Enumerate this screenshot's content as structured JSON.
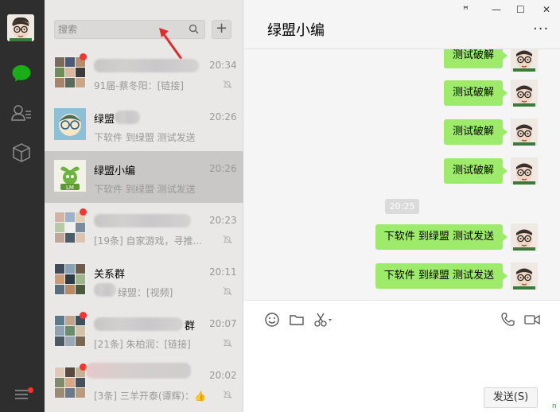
{
  "search": {
    "placeholder": "搜索"
  },
  "add_label": "+",
  "chats": [
    {
      "name": "",
      "time": "20:34",
      "preview": "91届-蔡冬阳：[链接]",
      "unread": true,
      "muted": true,
      "active": false,
      "avatar": "group-grid"
    },
    {
      "name": "绿盟",
      "time": "20:26",
      "preview": "下软件 到绿盟 测试发送",
      "unread": false,
      "muted": false,
      "active": false,
      "avatar": "cartoon-face"
    },
    {
      "name": "绿盟小编",
      "time": "20:26",
      "preview": "下软件 到绿盟 测试发送",
      "unread": false,
      "muted": false,
      "active": true,
      "avatar": "lm-logo"
    },
    {
      "name": "",
      "time": "20:23",
      "preview": "[19条] 自家游戏，寻推...",
      "unread": true,
      "muted": true,
      "active": false,
      "avatar": "group-grid"
    },
    {
      "name": "关系群",
      "time": "20:11",
      "preview": "绿盟：[视频]",
      "unread": false,
      "muted": true,
      "active": false,
      "avatar": "group-grid"
    },
    {
      "name": "群",
      "time": "20:07",
      "preview": "[21条] 朱柏润：[链接]",
      "unread": true,
      "muted": true,
      "active": false,
      "avatar": "group-grid"
    },
    {
      "name": "",
      "time": "20:02",
      "preview": "[3条] 三羊开泰(谭辉)：👍",
      "unread": true,
      "muted": true,
      "active": false,
      "avatar": "group-grid"
    }
  ],
  "window_controls": {
    "pin": "ꟸ",
    "minimize": "—",
    "maximize": "☐",
    "close": "✕"
  },
  "chat": {
    "title": "绿盟小编",
    "more": "···",
    "messages": [
      {
        "text": "测试破解"
      },
      {
        "text": "测试破解"
      },
      {
        "text": "测试破解"
      },
      {
        "text": "测试破解"
      },
      {
        "text": "下软件 到绿盟 测试发送"
      },
      {
        "text": "下软件 到绿盟 测试发送"
      }
    ],
    "timestamp": "20:25",
    "send_label": "发送(S)"
  },
  "corner_mark": "n",
  "colors": {
    "accent": "#07c160",
    "bubble": "#9eea6a",
    "unread": "#f43530",
    "rail": "#2e2e2e"
  }
}
